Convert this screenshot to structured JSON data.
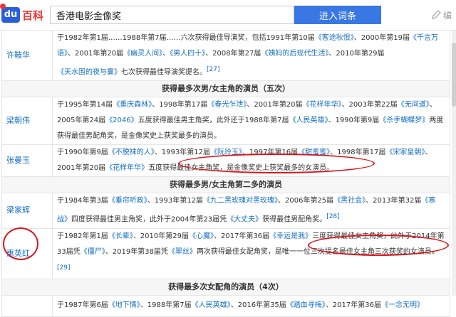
{
  "header": {
    "logo_du": "du",
    "logo_text": "百科",
    "search_value": "香港电影金像奖",
    "enter_button": "进入词条",
    "edit_label": "编"
  },
  "rows": [
    {
      "type": "person",
      "name": "许鞍华",
      "height": 66,
      "parts": [
        {
          "t": "于1982年第1届……1988年第7届……六次获得最佳导演奖，包括1991年第10届"
        },
        {
          "l": "《客途秋恨》"
        },
        {
          "t": "、2000年第19届"
        },
        {
          "l": "《千言万语》"
        },
        {
          "t": "、2001年第20届"
        },
        {
          "l": "《幽灵人间》"
        },
        {
          "t": "、"
        },
        {
          "l": "《男人四十》"
        },
        {
          "t": "、2008年第27届"
        },
        {
          "l": "《姨妈的后现代生活》"
        },
        {
          "t": "、2010年第29届"
        },
        {
          "l": "《天水围的夜与雾》"
        },
        {
          "t": "七次获得最佳导演奖提名。"
        },
        {
          "r": "[27]"
        }
      ]
    },
    {
      "type": "section",
      "text": "获得最多次男/女主角的演员（五次）"
    },
    {
      "type": "person",
      "name": "梁朝伟",
      "height": 66,
      "parts": [
        {
          "t": "于1995年第14届"
        },
        {
          "l": "《重庆森林》"
        },
        {
          "t": "、1998年第17届"
        },
        {
          "l": "《春光乍泄》"
        },
        {
          "t": "、2001年第20届"
        },
        {
          "l": "《花样年华》"
        },
        {
          "t": "、2003年第22届"
        },
        {
          "l": "《无间道》"
        },
        {
          "t": "、2005年第24届"
        },
        {
          "l": "《2046》"
        },
        {
          "t": "五度获得最佳男主角奖，此外还于1988年第7届"
        },
        {
          "l": "《人民英雄》"
        },
        {
          "t": "、1990年第9届"
        },
        {
          "l": "《杀手蝴蝶梦》"
        },
        {
          "t": "两度获得最佳男配角奖，是金像奖史上获奖最多的演员。"
        }
      ]
    },
    {
      "type": "person",
      "name": "张曼玉",
      "height": 44,
      "parts": [
        {
          "t": "于1990年第9届"
        },
        {
          "l": "《不脱袜的人》"
        },
        {
          "t": "、1993年第12届"
        },
        {
          "l": "《阮玲玉》"
        },
        {
          "t": "、1997年第16届"
        },
        {
          "l": "《甜蜜蜜》"
        },
        {
          "t": "、1998年第17届"
        },
        {
          "l": "《宋家皇朝》"
        },
        {
          "t": "、2001年第20届"
        },
        {
          "l": "《花样年华》"
        },
        {
          "t": "五度获得最佳女主角奖，是金像奖史上获奖最多的女演员。"
        }
      ]
    },
    {
      "type": "section",
      "text": "获得最多男/女主角第二多的演员"
    },
    {
      "type": "person",
      "name": "梁家辉",
      "height": 44,
      "parts": [
        {
          "t": "于1984年第3届"
        },
        {
          "l": "《垂帘听政》"
        },
        {
          "t": "、1993年第12届"
        },
        {
          "l": "《九二黑玫瑰对黑玫瑰》"
        },
        {
          "t": "、2006年第25届"
        },
        {
          "l": "《黑社会》"
        },
        {
          "t": "、2013年第32届"
        },
        {
          "l": "《寒战》"
        },
        {
          "t": "四度获得最佳男主角奖，此外于2004年第23届凭"
        },
        {
          "l": "《大丈夫》"
        },
        {
          "t": "获得最佳男配角奖。"
        },
        {
          "r": "[28]"
        }
      ]
    },
    {
      "type": "person",
      "name": "惠英红",
      "height": 66,
      "parts": [
        {
          "t": "于1982年第1届"
        },
        {
          "l": "《长辈》"
        },
        {
          "t": "、2010年第29届"
        },
        {
          "l": "《心魔》"
        },
        {
          "t": "、2017年第36届"
        },
        {
          "l": "《幸运是我》"
        },
        {
          "t": "三度获得最佳女主角奖，此外于2014年第33届凭"
        },
        {
          "l": "《僵尸》"
        },
        {
          "t": "、2019年第38届凭"
        },
        {
          "l": "《翠丝》"
        },
        {
          "t": "两次获得最佳女配角奖，是唯一一位三次提名最佳女主角三次获奖的女演员。"
        },
        {
          "r": "[29]"
        }
      ]
    },
    {
      "type": "section",
      "text": "获得最多次女配角的演员（4次）"
    },
    {
      "type": "person",
      "name": "",
      "height": 30,
      "parts": [
        {
          "t": "于1987年第6届"
        },
        {
          "l": "《地下情》"
        },
        {
          "t": "、1988年第7届"
        },
        {
          "l": "《人民英雄》"
        },
        {
          "t": "、2016年第35届"
        },
        {
          "l": "《踏血寻梅》"
        },
        {
          "t": "、2017年第36届"
        },
        {
          "l": "《一念无明》"
        }
      ]
    }
  ]
}
